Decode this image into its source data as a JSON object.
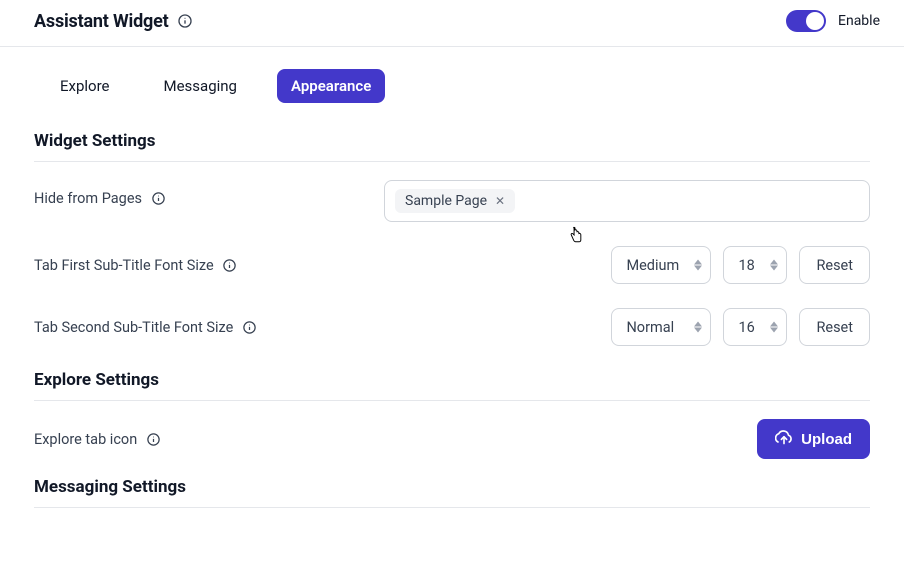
{
  "header": {
    "title": "Assistant Widget",
    "enable_label": "Enable",
    "enabled": true
  },
  "tabs": [
    {
      "id": "explore",
      "label": "Explore",
      "active": false
    },
    {
      "id": "messaging",
      "label": "Messaging",
      "active": false
    },
    {
      "id": "appearance",
      "label": "Appearance",
      "active": true
    }
  ],
  "sections": {
    "widget_settings_title": "Widget Settings",
    "explore_settings_title": "Explore Settings",
    "messaging_settings_title": "Messaging Settings"
  },
  "hide_from_pages": {
    "label": "Hide from Pages",
    "chips": [
      {
        "label": "Sample Page"
      }
    ]
  },
  "tab_first": {
    "label": "Tab First Sub-Title Font Size",
    "size_label": "Medium",
    "size_value": "18",
    "reset_label": "Reset"
  },
  "tab_second": {
    "label": "Tab Second Sub-Title Font Size",
    "size_label": "Normal",
    "size_value": "16",
    "reset_label": "Reset"
  },
  "explore_icon": {
    "label": "Explore tab icon",
    "upload_label": "Upload"
  },
  "colors": {
    "accent": "#4338ca"
  }
}
